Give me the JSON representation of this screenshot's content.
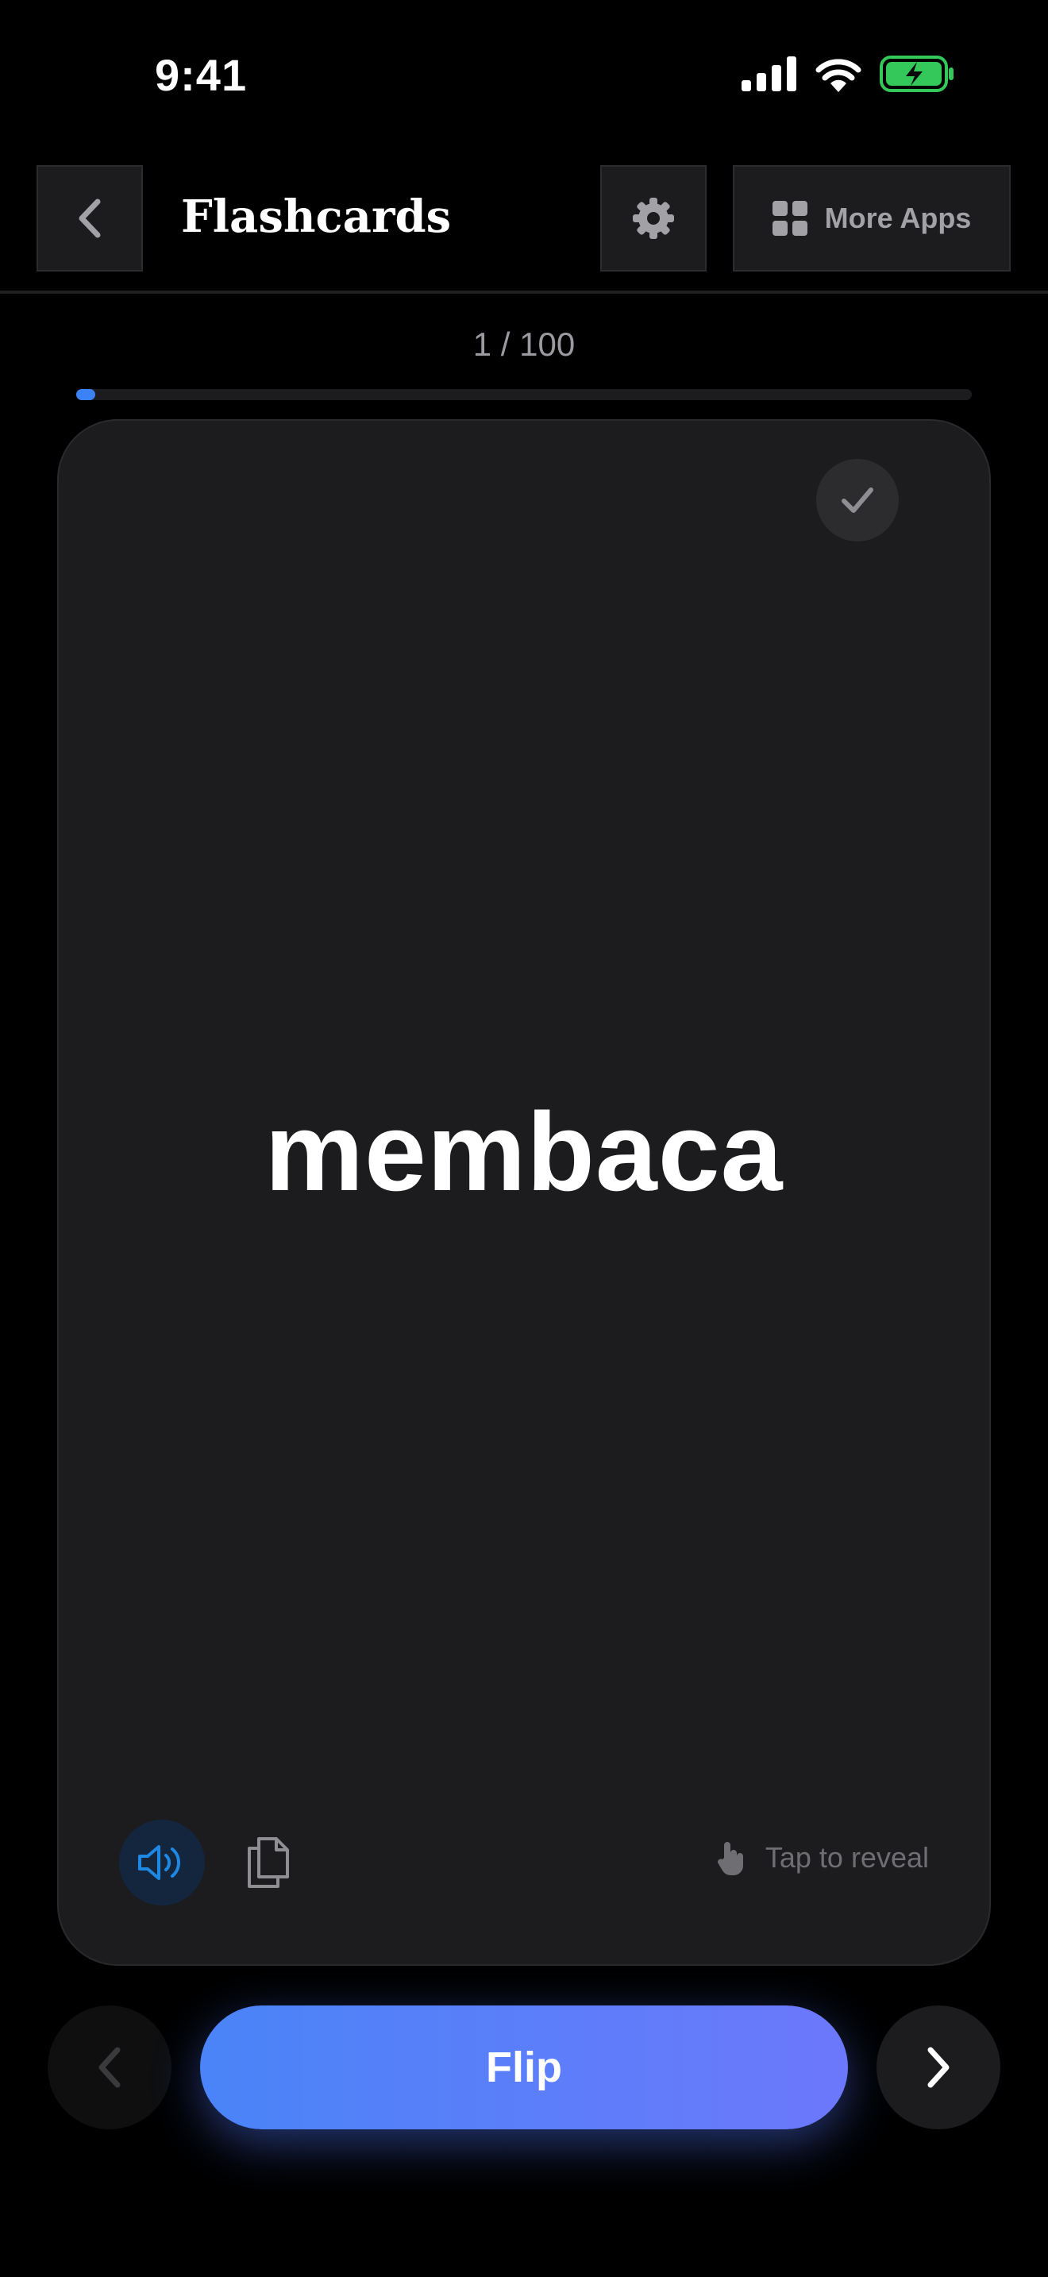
{
  "status_bar": {
    "time": "9:41"
  },
  "header": {
    "title": "Flashcards",
    "more_apps_label": "More Apps",
    "back_icon": "chevron-left-icon",
    "settings_icon": "gear-icon",
    "more_apps_icon": "grid-icon"
  },
  "progress": {
    "label": "1 / 100",
    "fraction": 0.01,
    "color": "#3b82f6"
  },
  "card": {
    "word": "membaca",
    "reveal_hint": "Tap to reveal",
    "audio_color": "#1e88e5"
  },
  "controls": {
    "flip_label": "Flip"
  }
}
